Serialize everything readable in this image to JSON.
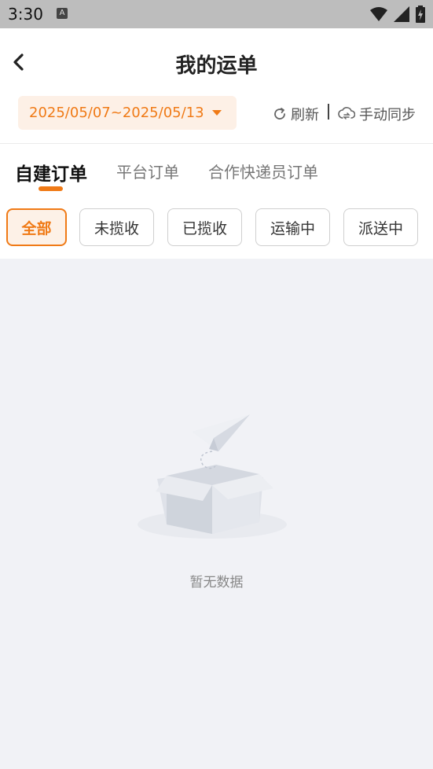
{
  "status_bar": {
    "time": "3:30",
    "notification_icon": "A"
  },
  "header": {
    "title": "我的运单"
  },
  "toolbar": {
    "date_range": "2025/05/07~2025/05/13",
    "refresh_label": "刷新",
    "sync_label": "手动同步"
  },
  "tabs": [
    {
      "label": "自建订单",
      "active": true
    },
    {
      "label": "平台订单",
      "active": false
    },
    {
      "label": "合作快递员订单",
      "active": false
    }
  ],
  "filters": [
    {
      "label": "全部",
      "active": true
    },
    {
      "label": "未揽收",
      "active": false
    },
    {
      "label": "已揽收",
      "active": false
    },
    {
      "label": "运输中",
      "active": false
    },
    {
      "label": "派送中",
      "active": false
    }
  ],
  "empty_state": {
    "message": "暂无数据"
  },
  "colors": {
    "accent": "#f07a16",
    "accent_bg": "#fdf0e6",
    "content_bg": "#f1f2f6"
  }
}
